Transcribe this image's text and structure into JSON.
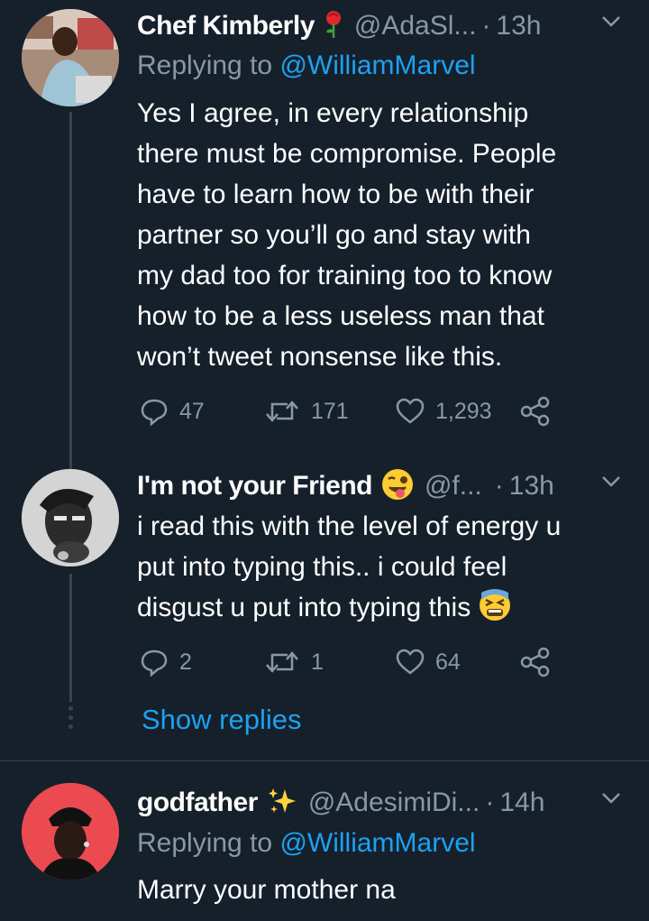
{
  "tweets": [
    {
      "name": "Chef Kimberly",
      "handle": "@AdaSl...",
      "dot": "·",
      "time": "13h",
      "replying_label": "Replying to",
      "replying_to": "@WilliamMarvel",
      "text": "Yes I agree, in every relationship\nthere must be compromise. People\nhave to learn how to be with their\npartner so you’ll go and stay with\nmy dad too for training too to know\nhow to be a less useless man that\nwon’t tweet nonsense like this.",
      "replies": "47",
      "retweets": "171",
      "likes": "1,293"
    },
    {
      "name": "I'm not your Friend",
      "handle": "@f...",
      "dot": "·",
      "time": "13h",
      "text": "i read this with the level of energy u\nput into typing this.. i could feel\ndisgust u put into typing this",
      "replies": "2",
      "retweets": "1",
      "likes": "64",
      "show_replies": "Show replies"
    },
    {
      "name": "godfather",
      "handle": "@AdesimiDi...",
      "dot": "·",
      "time": "14h",
      "replying_label": "Replying to",
      "replying_to": "@WilliamMarvel",
      "text": "Marry your mother na"
    }
  ],
  "colors": {
    "background": "#15202b",
    "accent": "#1da1f2",
    "muted": "#8899a6"
  }
}
